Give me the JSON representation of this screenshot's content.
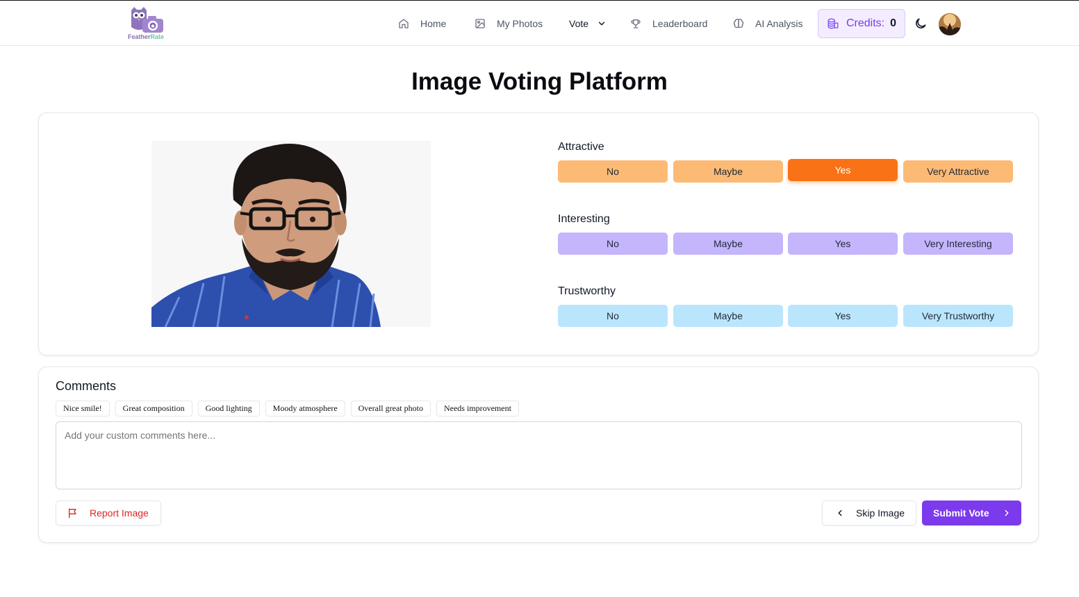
{
  "header": {
    "logo": {
      "brand_part1": "Feather",
      "brand_part2": "Rate",
      "icon": "owl-camera-logo"
    },
    "nav": [
      {
        "label": "Home",
        "icon": "home-icon"
      },
      {
        "label": "My Photos",
        "icon": "image-icon"
      },
      {
        "label": "Vote",
        "icon": "chevron-down-icon"
      },
      {
        "label": "Leaderboard",
        "icon": "trophy-icon"
      },
      {
        "label": "AI Analysis",
        "icon": "brain-icon"
      }
    ],
    "credits": {
      "label": "Credits:",
      "value": "0",
      "icon": "coins-icon"
    },
    "theme_icon": "moon-icon",
    "avatar": "user-avatar"
  },
  "page": {
    "title": "Image Voting Platform"
  },
  "voting": {
    "photo": "portrait-photo",
    "groups": [
      {
        "title": "Attractive",
        "color": "#fdba74",
        "active_color": "#f97316",
        "selected": "Yes",
        "options": [
          "No",
          "Maybe",
          "Yes",
          "Very Attractive"
        ]
      },
      {
        "title": "Interesting",
        "color": "#c4b5fd",
        "options": [
          "No",
          "Maybe",
          "Yes",
          "Very Interesting"
        ]
      },
      {
        "title": "Trustworthy",
        "color": "#bae6fd",
        "options": [
          "No",
          "Maybe",
          "Yes",
          "Very Trustworthy"
        ]
      }
    ]
  },
  "comments": {
    "title": "Comments",
    "chips": [
      "Nice smile!",
      "Great composition",
      "Good lighting",
      "Moody atmosphere",
      "Overall great photo",
      "Needs improvement"
    ],
    "placeholder": "Add your custom comments here...",
    "report_label": "Report Image",
    "skip_label": "Skip Image",
    "submit_label": "Submit Vote",
    "submit_color": "#7c3aed"
  }
}
